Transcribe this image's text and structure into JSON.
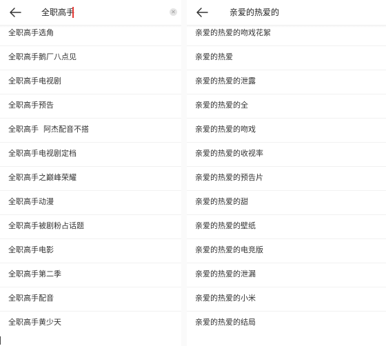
{
  "left": {
    "query": "全职高手",
    "icons": {
      "back": "back-arrow-icon",
      "clear": "clear-icon"
    },
    "suggestions": [
      "全职高手选角",
      "全职高手鹅厂八点见",
      "全职高手电视剧",
      "全职高手预告",
      "全职高手  阿杰配音不搭",
      "全职高手电视剧定档",
      "全职高手之巅峰荣耀",
      "全职高手动漫",
      "全职高手被剧粉占话题",
      "全职高手电影",
      "全职高手第二季",
      "全职高手配音",
      "全职高手黄少天"
    ]
  },
  "right": {
    "query": "亲爱的热爱的",
    "icons": {
      "back": "back-arrow-icon"
    },
    "suggestions": [
      "亲爱的热爱的吻戏花絮",
      "亲爱的热爱",
      "亲爱的热爱的泄露",
      "亲爱的热爱的全",
      "亲爱的热爱的吻戏",
      "亲爱的热爱的收视率",
      "亲爱的热爱的预告片",
      "亲爱的热爱的甜",
      "亲爱的热爱的壁纸",
      "亲爱的热爱的电竞版",
      "亲爱的热爱的泄漏",
      "亲爱的热爱的小米",
      "亲爱的热爱的结局"
    ]
  },
  "colors": {
    "caret": "#e53935",
    "text": "#333333",
    "divider": "#f1f1f1"
  }
}
